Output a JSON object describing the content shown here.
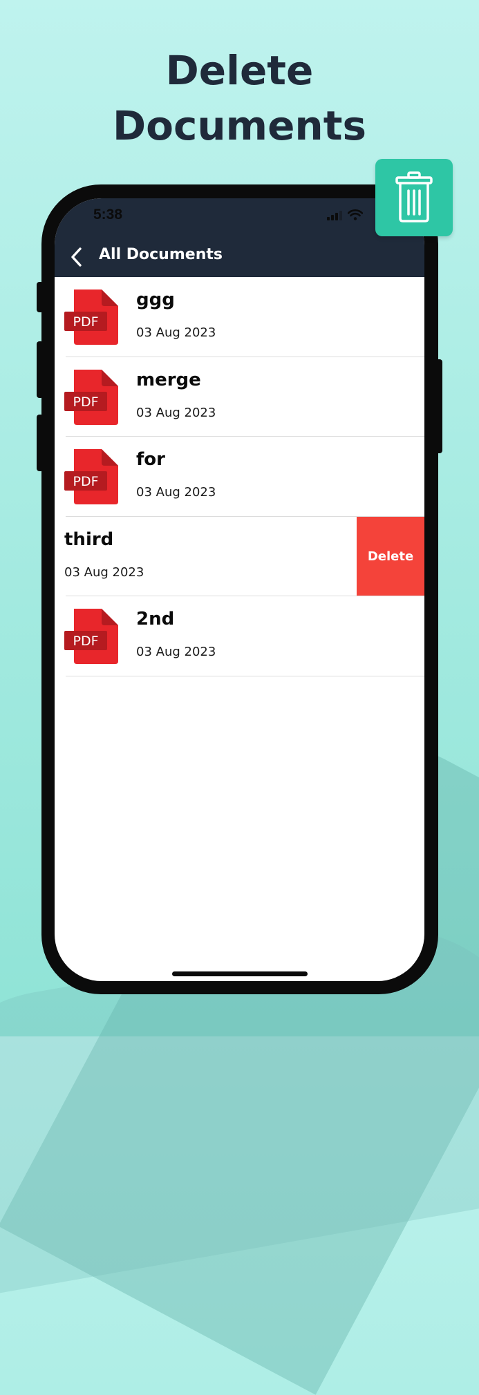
{
  "promo": {
    "headline_line1": "Delete",
    "headline_line2": "Documents"
  },
  "status_bar": {
    "time": "5:38",
    "icons": [
      "cellular-signal-icon",
      "wifi-icon"
    ]
  },
  "nav": {
    "back_icon": "chevron-left-icon",
    "title": "All Documents"
  },
  "file_icon_label": "PDF",
  "documents": [
    {
      "name": "ggg",
      "date": "03 Aug 2023",
      "swiped": false
    },
    {
      "name": "merge",
      "date": "03 Aug 2023",
      "swiped": false
    },
    {
      "name": "for",
      "date": "03 Aug 2023",
      "swiped": false
    },
    {
      "name": "third",
      "date": "03 Aug 2023",
      "swiped": true
    },
    {
      "name": "2nd",
      "date": "03 Aug 2023",
      "swiped": false
    }
  ],
  "row_action": {
    "delete_label": "Delete"
  },
  "colors": {
    "headline": "#1f2a3a",
    "appbar": "#1f2a3a",
    "pdf_red": "#e8262b",
    "delete_red": "#f4433a",
    "accent_teal": "#2ec6a5",
    "background": "#a9ece3"
  }
}
